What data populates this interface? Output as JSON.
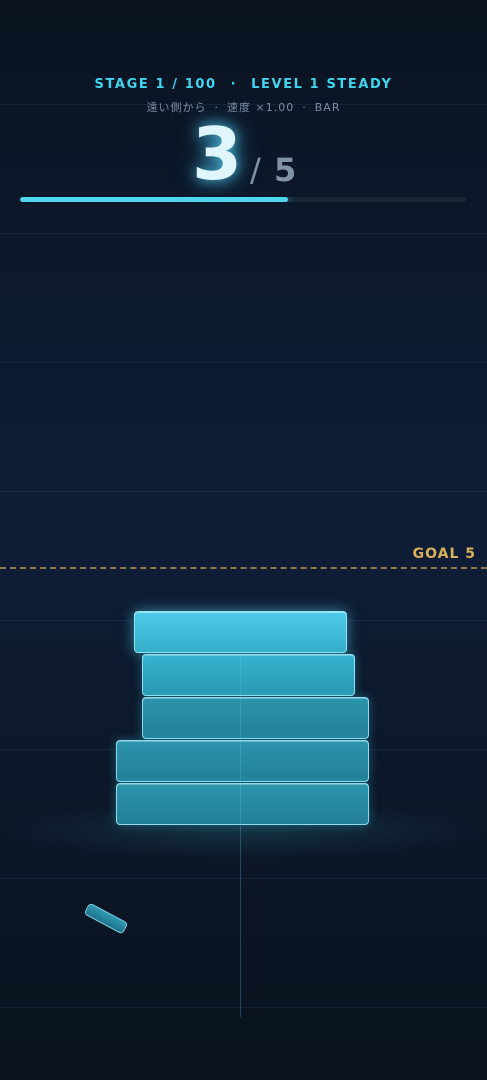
{
  "header": {
    "stage": "STAGE 1 / 100",
    "level": "LEVEL 1 STEADY",
    "sub_mode": "遠い側から",
    "sub_speed": "速度 ×1.00",
    "sub_type": "BAR"
  },
  "counter": {
    "current": "3",
    "slash": "/",
    "total": "5"
  },
  "progress": {
    "fraction": 0.6
  },
  "goal": {
    "label": "GOAL 5"
  },
  "stack": {
    "block_count": 5,
    "fragment_count": 1
  },
  "colors": {
    "accent": "#3fd6f0",
    "goal": "#d9b25a",
    "block": "#36b4cf"
  }
}
